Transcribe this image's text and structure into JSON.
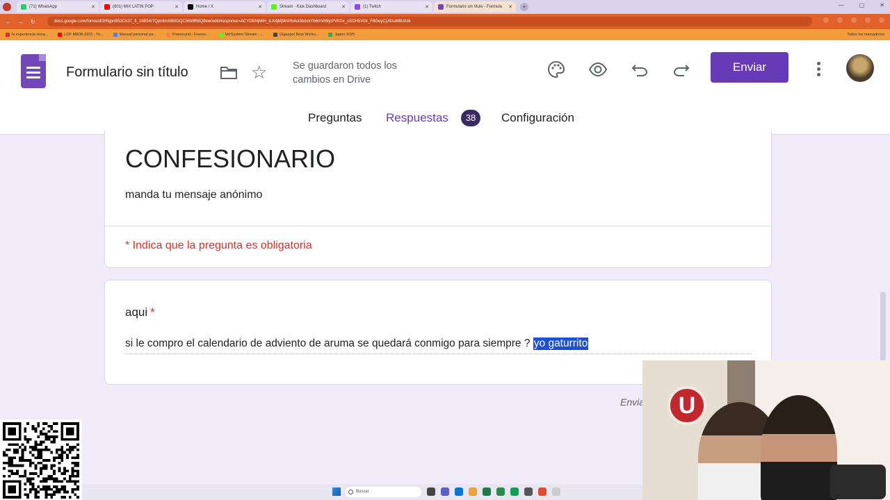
{
  "browser": {
    "tabs": [
      {
        "title": "(71) WhatsApp",
        "color": "#25d366"
      },
      {
        "title": "(801) MIX LATIN POP",
        "color": "#ff0000"
      },
      {
        "title": "Home / X",
        "color": "#000000"
      },
      {
        "title": "Stream - Kick Dashboard",
        "color": "#53fc18"
      },
      {
        "title": "(1) Twitch",
        "color": "#9146ff"
      },
      {
        "title": "Formulario sin título - Formula",
        "color": "#7248b9",
        "active": true
      }
    ],
    "url": "docs.google.com/forms/d/1RkjpnB52Ck37_fl_19B54/7Qpn8m58l0GQC56k9R8Q8ew/edit#response=ACYDBNjMiH_iLX4jMjWsRb4ui3bdckYb6mVt6IjcPVhDx_sSOH5VGr_F8GeyCjJ4zuM8UtUk",
    "bookmarks": [
      {
        "label": "la experiencia reina...",
        "color": "#d93025"
      },
      {
        "label": "LOF M8D8-2015 - Yo...",
        "color": "#ff0000"
      },
      {
        "label": "Manual personal pa...",
        "color": "#4285f4"
      },
      {
        "label": "Freesound - Freeso...",
        "color": "#ff7f50"
      },
      {
        "label": "VerSystem Stream - ...",
        "color": "#53fc18"
      },
      {
        "label": "Gigaspot Beat Works...",
        "color": "#444444"
      },
      {
        "label": "Japon 2025",
        "color": "#34a853"
      }
    ],
    "bookmarks_right": "Todos los marcadores"
  },
  "header": {
    "title": "Formulario sin título",
    "save_status": "Se guardaron todos los cambios en Drive",
    "send_label": "Enviar",
    "icons": [
      "palette-icon",
      "preview-eye-icon",
      "undo-icon",
      "redo-icon",
      "more-vert-icon"
    ]
  },
  "tabs": {
    "questions": "Preguntas",
    "responses": "Respuestas",
    "responses_count": "38",
    "settings": "Configuración"
  },
  "form": {
    "heading": "CONFESIONARIO",
    "description": "manda tu mensaje anónimo",
    "required_note": "* Indica que la pregunta es obligatoria",
    "question_label": "aqui",
    "required_star": "*",
    "answer_text": "si le compro el calendario de adviento de aruma se quedará conmigo para siempre ? ",
    "answer_selected": "yo gaturrito",
    "sent_text": "Envia"
  },
  "taskbar": {
    "search_placeholder": "Buscar"
  },
  "webcam": {
    "logo_letter": "U"
  },
  "colors": {
    "accent": "#673ab7",
    "required": "#d93025",
    "background": "#f0ebf8"
  }
}
